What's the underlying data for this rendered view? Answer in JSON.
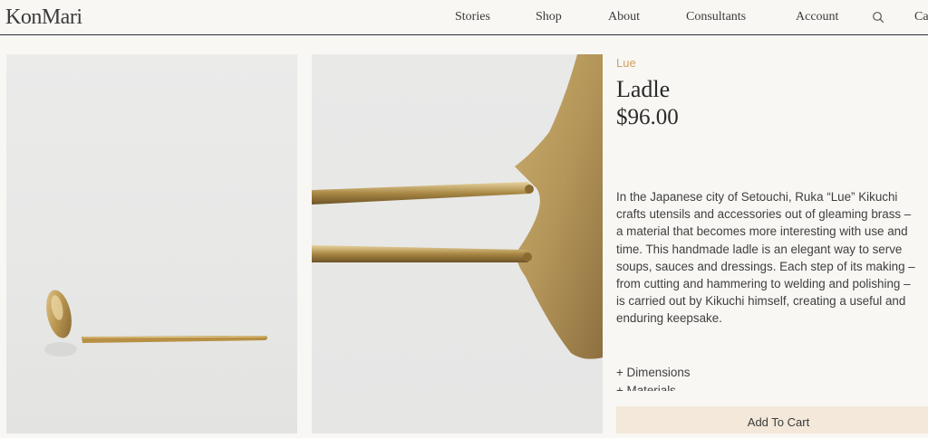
{
  "header": {
    "logo": "KonMari",
    "nav": [
      "Stories",
      "Shop",
      "About",
      "Consultants",
      "Account"
    ],
    "cart_partial": "Ca"
  },
  "product": {
    "brand": "Lue",
    "title": "Ladle",
    "price": "$96.00",
    "description": "In the Japanese city of Setouchi, Ruka “Lue” Kikuchi crafts utensils and accessories out of gleaming brass – a material that becomes more interesting with use and time. This handmade ladle is an elegant way to serve soups, sauces and dressings. Each step of its making – from cutting and hammering to welding and polishing – is carried out by Kikuchi himself, creating a useful and enduring keepsake.",
    "accordion": [
      "+ Dimensions",
      "+ Materials"
    ],
    "add_to_cart": "Add To Cart"
  },
  "colors": {
    "accent": "#d1a062",
    "button_bg": "#f3e8d9",
    "rule": "#2b2f3a"
  }
}
